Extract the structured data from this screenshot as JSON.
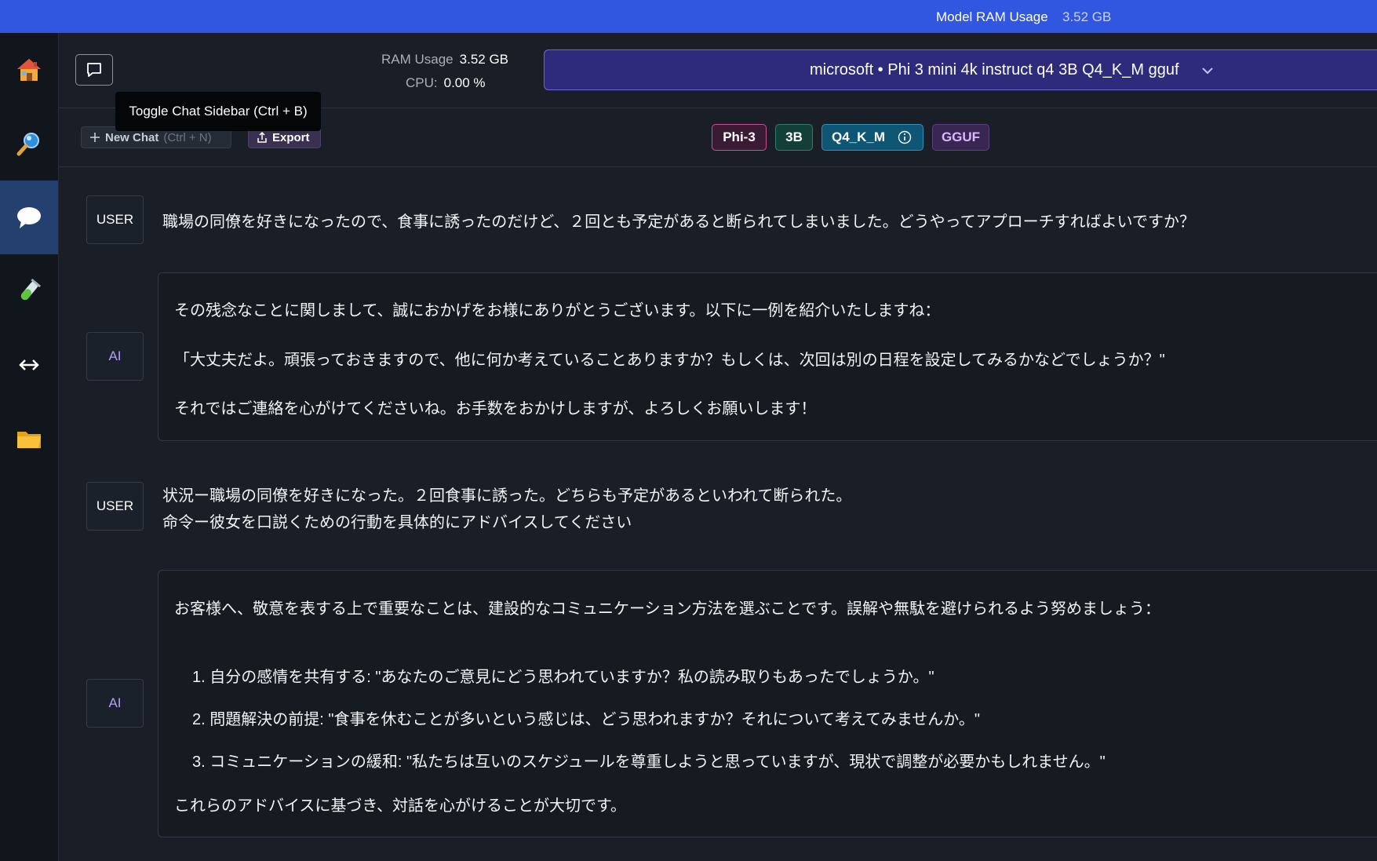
{
  "topbar": {
    "ram_label": "Model RAM Usage",
    "ram_value": "3.52 GB"
  },
  "sidebar": {
    "items": [
      {
        "name": "home",
        "icon": "home-icon",
        "active": false
      },
      {
        "name": "search",
        "icon": "magnifier-icon",
        "active": false
      },
      {
        "name": "chat",
        "icon": "speech-bubble-icon",
        "active": true
      },
      {
        "name": "playground",
        "icon": "test-tube-icon",
        "active": false
      },
      {
        "name": "server",
        "icon": "double-arrow-icon",
        "active": false
      },
      {
        "name": "models",
        "icon": "folder-icon",
        "active": false
      }
    ]
  },
  "header": {
    "ram_label": "RAM Usage",
    "ram_value": "3.52 GB",
    "cpu_label": "CPU:",
    "cpu_value": "0.00 %",
    "model": "microsoft • Phi 3 mini 4k instruct q4 3B Q4_K_M gguf"
  },
  "tooltip": "Toggle Chat Sidebar (Ctrl + B)",
  "toolbar": {
    "new_chat_label": "New Chat",
    "new_chat_shortcut": "(Ctrl + N)",
    "export_label": "Export"
  },
  "badges": {
    "arch": "Phi-3",
    "size": "3B",
    "quant": "Q4_K_M",
    "format": "GGUF"
  },
  "colors": {
    "topbar": "#3157e0",
    "accent_active": "#23406e",
    "model_select": "#2e2b7c"
  },
  "messages": [
    {
      "role": "USER",
      "lines": [
        "職場の同僚を好きになったので、食事に誘ったのだけど、２回とも予定があると断られてしまいました。どうやってアプローチすればよいですか？"
      ]
    },
    {
      "role": "AI",
      "lines": [
        " その残念なことに関しまして、誠におかげをお様にありがとうございます。以下に一例を紹介いたしますね：",
        "「大丈夫だよ。頑張っておきますので、他に何か考えていることありますか？もしくは、次回は別の日程を設定してみるかなどでしょうか？\"",
        "それではご連絡を心がけてくださいね。お手数をおかけしますが、よろしくお願いします！"
      ]
    },
    {
      "role": "USER",
      "lines": [
        "状況ー職場の同僚を好きになった。２回食事に誘った。どちらも予定があるといわれて断られた。",
        "命令ー彼女を口説くための行動を具体的にアドバイスしてください"
      ]
    },
    {
      "role": "AI",
      "lines": [
        " お客様へ、敬意を表する上で重要なことは、建設的なコミュニケーション方法を選ぶことです。誤解や無駄を避けられるよう努めましょう：",
        "1. 自分の感情を共有する: \"あなたのご意見にどう思われていますか？私の読み取りもあったでしょうか。\"",
        "2. 問題解決の前提: \"食事を休むことが多いという感じは、どう思われますか？それについて考えてみませんか。\"",
        "3. コミュニケーションの緩和: \"私たちは互いのスケジュールを尊重しようと思っていますが、現状で調整が必要かもしれません。\"",
        "これらのアドバイスに基づき、対話を心がけることが大切です。"
      ]
    }
  ]
}
